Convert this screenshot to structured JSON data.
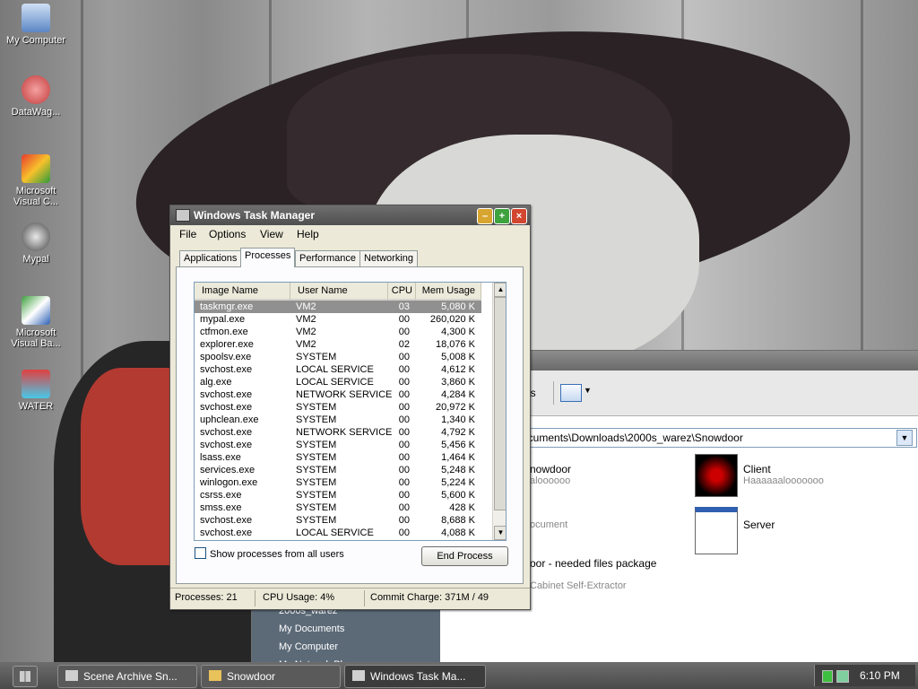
{
  "desktop": {
    "icons": [
      {
        "label": "My Computer",
        "icon": "my-computer-icon"
      },
      {
        "label": "DataWag...",
        "icon": "datawag-shortcut-icon"
      },
      {
        "label": "Microsoft Visual C...",
        "icon": "visual-c-shortcut-icon"
      },
      {
        "label": "Mypal",
        "icon": "mypal-icon"
      },
      {
        "label": "Microsoft Visual Ba...",
        "icon": "visual-basic-shortcut-icon"
      },
      {
        "label": "WATER",
        "icon": "water-tap-icon"
      }
    ]
  },
  "explorer": {
    "toolbar_fragment": "ers",
    "address": "ocuments\\Downloads\\2000s_warez\\Snowdoor",
    "files": [
      {
        "name": "nowdoor",
        "sub": "aloooooo"
      },
      {
        "name": "Client",
        "sub": "Haaaaaalooooooo"
      },
      {
        "name": "",
        "sub": "ocument"
      },
      {
        "name": "Server",
        "sub": ""
      },
      {
        "name": "oor - needed files package",
        "sub": "Cabinet Self-Extractor"
      }
    ],
    "left_pane": [
      "2000s_warez",
      "My Documents",
      "My Computer",
      "My Network Pl..."
    ]
  },
  "task_manager": {
    "title": "Windows Task Manager",
    "menu": [
      "File",
      "Options",
      "View",
      "Help"
    ],
    "tabs": [
      "Applications",
      "Processes",
      "Performance",
      "Networking"
    ],
    "active_tab": "Processes",
    "columns": [
      "Image Name",
      "User Name",
      "CPU",
      "Mem Usage"
    ],
    "rows": [
      [
        "taskmgr.exe",
        "VM2",
        "03",
        "5,080 K"
      ],
      [
        "mypal.exe",
        "VM2",
        "00",
        "260,020 K"
      ],
      [
        "ctfmon.exe",
        "VM2",
        "00",
        "4,300 K"
      ],
      [
        "explorer.exe",
        "VM2",
        "02",
        "18,076 K"
      ],
      [
        "spoolsv.exe",
        "SYSTEM",
        "00",
        "5,008 K"
      ],
      [
        "svchost.exe",
        "LOCAL SERVICE",
        "00",
        "4,612 K"
      ],
      [
        "alg.exe",
        "LOCAL SERVICE",
        "00",
        "3,860 K"
      ],
      [
        "svchost.exe",
        "NETWORK SERVICE",
        "00",
        "4,284 K"
      ],
      [
        "svchost.exe",
        "SYSTEM",
        "00",
        "20,972 K"
      ],
      [
        "uphclean.exe",
        "SYSTEM",
        "00",
        "1,340 K"
      ],
      [
        "svchost.exe",
        "NETWORK SERVICE",
        "00",
        "4,792 K"
      ],
      [
        "svchost.exe",
        "SYSTEM",
        "00",
        "5,456 K"
      ],
      [
        "lsass.exe",
        "SYSTEM",
        "00",
        "1,464 K"
      ],
      [
        "services.exe",
        "SYSTEM",
        "00",
        "5,248 K"
      ],
      [
        "winlogon.exe",
        "SYSTEM",
        "00",
        "5,224 K"
      ],
      [
        "csrss.exe",
        "SYSTEM",
        "00",
        "5,600 K"
      ],
      [
        "smss.exe",
        "SYSTEM",
        "00",
        "428 K"
      ],
      [
        "svchost.exe",
        "SYSTEM",
        "00",
        "8,688 K"
      ],
      [
        "svchost.exe",
        "LOCAL SERVICE",
        "00",
        "4,088 K"
      ]
    ],
    "selected_row": 0,
    "show_all_label": "Show processes from all users",
    "show_all_checked": false,
    "end_process_label": "End Process",
    "status": {
      "processes": "Processes: 21",
      "cpu": "CPU Usage: 4%",
      "commit": "Commit Charge: 371M / 49"
    }
  },
  "taskbar": {
    "buttons": [
      {
        "label": "Scene Archive Sn...",
        "icon": "scene-archive-icon"
      },
      {
        "label": "Snowdoor",
        "icon": "folder-icon"
      },
      {
        "label": "Windows Task Ma...",
        "icon": "task-manager-icon"
      }
    ],
    "active_button": 2,
    "clock": "6:10 PM"
  }
}
